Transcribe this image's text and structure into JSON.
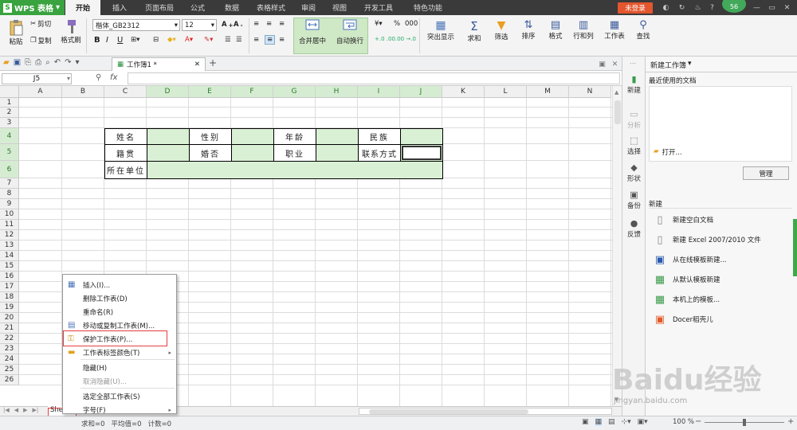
{
  "app": {
    "name": "WPS 表格",
    "logo_letter": "S"
  },
  "menu_tabs": [
    "开始",
    "插入",
    "页面布局",
    "公式",
    "数据",
    "表格样式",
    "审阅",
    "视图",
    "开发工具",
    "特色功能"
  ],
  "active_tab": "开始",
  "login_label": "未登录",
  "badge_count": "56",
  "ribbon": {
    "paste": "粘贴",
    "cut": "剪切",
    "copy": "复制",
    "format_painter": "格式刷",
    "font_name": "楷体_GB2312",
    "font_size": "12",
    "bold": "B",
    "italic": "I",
    "underline": "U",
    "merge_center": "合并居中",
    "wrap_text": "自动换行",
    "percent": "%",
    "thousands": "000",
    "dec_inc": "+.0 .00",
    "dec_dec": ".00 →.0",
    "cond_format": "突出显示",
    "sum": "求和",
    "filter": "筛选",
    "sort": "排序",
    "format": "格式",
    "rows_cols": "行和列",
    "worksheet": "工作表",
    "find": "查找"
  },
  "document_tab": "工作簿1 *",
  "formula_bar": {
    "cell_ref": "J5",
    "fx": "fx",
    "value": ""
  },
  "columns": [
    "A",
    "B",
    "C",
    "D",
    "E",
    "F",
    "G",
    "H",
    "I",
    "J",
    "K",
    "L",
    "M",
    "N"
  ],
  "selected_columns": [
    "D",
    "E",
    "F",
    "G",
    "H",
    "I",
    "J"
  ],
  "rows": [
    "1",
    "2",
    "3",
    "4",
    "5",
    "6",
    "7",
    "8",
    "9",
    "10",
    "11",
    "12",
    "13",
    "14",
    "15",
    "16",
    "17",
    "18",
    "19",
    "20",
    "21",
    "22",
    "23",
    "24",
    "25",
    "26"
  ],
  "selected_rows": [
    "4",
    "5",
    "6"
  ],
  "form_labels": {
    "name": "姓名",
    "gender": "性别",
    "age": "年龄",
    "ethnicity": "民族",
    "native_place": "籍贯",
    "marital": "婚否",
    "occupation": "职业",
    "contact": "联系方式",
    "workplace": "所在单位"
  },
  "context_menu": [
    {
      "label": "插入(I)...",
      "icon": "insert-sheet-icon",
      "disabled": false
    },
    {
      "label": "删除工作表(D)",
      "icon": "",
      "disabled": false
    },
    {
      "label": "重命名(R)",
      "icon": "",
      "disabled": false
    },
    {
      "label": "移动或复制工作表(M)...",
      "icon": "move-copy-icon",
      "disabled": false
    },
    {
      "label": "保护工作表(P)...",
      "icon": "protect-sheet-icon",
      "disabled": false
    },
    {
      "label": "工作表标签颜色(T)",
      "icon": "tab-color-icon",
      "disabled": false,
      "submenu": true
    },
    {
      "label": "隐藏(H)",
      "icon": "",
      "disabled": false
    },
    {
      "label": "取消隐藏(U)...",
      "icon": "",
      "disabled": true
    },
    {
      "label": "选定全部工作表(S)",
      "icon": "",
      "disabled": false
    },
    {
      "label": "字号(F)",
      "icon": "",
      "disabled": false,
      "submenu": true
    }
  ],
  "sheet_tab": "She",
  "status": {
    "sum": "求和=0",
    "average": "平均值=0",
    "count": "计数=0",
    "zoom": "100 %"
  },
  "right_sidebar": [
    {
      "label": "新建",
      "icon": "new-doc-icon",
      "disabled": false
    },
    {
      "label": "分析",
      "icon": "analyze-icon",
      "disabled": true
    },
    {
      "label": "选择",
      "icon": "select-icon",
      "disabled": false
    },
    {
      "label": "形状",
      "icon": "shape-icon",
      "disabled": false
    },
    {
      "label": "备份",
      "icon": "backup-icon",
      "disabled": false
    },
    {
      "label": "反馈",
      "icon": "feedback-icon",
      "disabled": false
    }
  ],
  "right_panel": {
    "title": "新建工作簿",
    "recent_heading": "最近使用的文档",
    "open_label": "打开...",
    "manage_label": "管理",
    "new_heading": "新建",
    "items": [
      {
        "label": "新建空白文档",
        "icon": "blank-doc-icon"
      },
      {
        "label": "新建 Excel 2007/2010 文件",
        "icon": "excel-doc-icon"
      },
      {
        "label": "从在线模板新建...",
        "icon": "online-template-icon"
      },
      {
        "label": "从默认模板新建",
        "icon": "default-template-icon"
      },
      {
        "label": "本机上的模板...",
        "icon": "local-template-icon"
      },
      {
        "label": "Docer稻壳儿",
        "icon": "docer-icon"
      }
    ]
  },
  "watermark": {
    "text": "Baidu经验",
    "url_text": "jingyan.baidu.com"
  },
  "colors": {
    "brand_green": "#39a33f",
    "selection_green": "#d9f0d4",
    "login_red": "#e3562e",
    "highlight_red": "#e43d3d"
  }
}
